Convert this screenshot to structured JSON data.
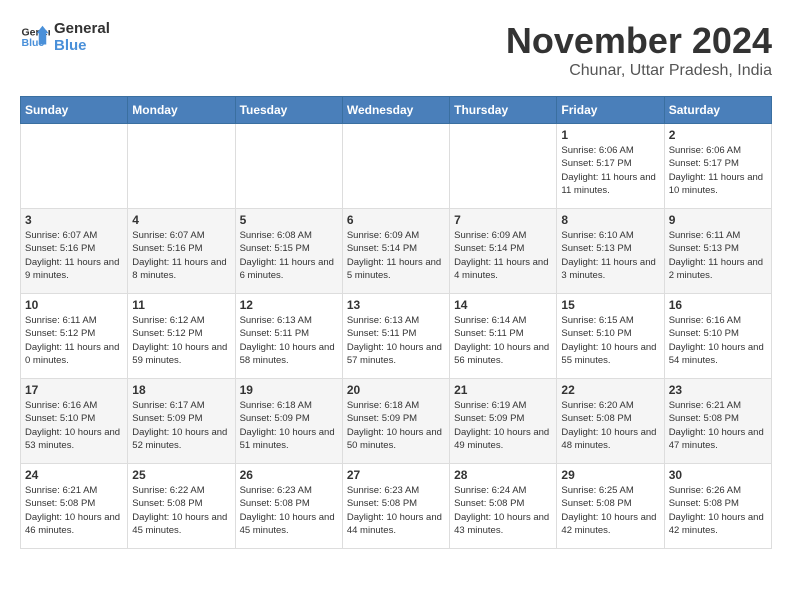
{
  "logo": {
    "line1": "General",
    "line2": "Blue"
  },
  "title": "November 2024",
  "subtitle": "Chunar, Uttar Pradesh, India",
  "headers": [
    "Sunday",
    "Monday",
    "Tuesday",
    "Wednesday",
    "Thursday",
    "Friday",
    "Saturday"
  ],
  "weeks": [
    [
      {
        "day": "",
        "info": ""
      },
      {
        "day": "",
        "info": ""
      },
      {
        "day": "",
        "info": ""
      },
      {
        "day": "",
        "info": ""
      },
      {
        "day": "",
        "info": ""
      },
      {
        "day": "1",
        "info": "Sunrise: 6:06 AM\nSunset: 5:17 PM\nDaylight: 11 hours and 11 minutes."
      },
      {
        "day": "2",
        "info": "Sunrise: 6:06 AM\nSunset: 5:17 PM\nDaylight: 11 hours and 10 minutes."
      }
    ],
    [
      {
        "day": "3",
        "info": "Sunrise: 6:07 AM\nSunset: 5:16 PM\nDaylight: 11 hours and 9 minutes."
      },
      {
        "day": "4",
        "info": "Sunrise: 6:07 AM\nSunset: 5:16 PM\nDaylight: 11 hours and 8 minutes."
      },
      {
        "day": "5",
        "info": "Sunrise: 6:08 AM\nSunset: 5:15 PM\nDaylight: 11 hours and 6 minutes."
      },
      {
        "day": "6",
        "info": "Sunrise: 6:09 AM\nSunset: 5:14 PM\nDaylight: 11 hours and 5 minutes."
      },
      {
        "day": "7",
        "info": "Sunrise: 6:09 AM\nSunset: 5:14 PM\nDaylight: 11 hours and 4 minutes."
      },
      {
        "day": "8",
        "info": "Sunrise: 6:10 AM\nSunset: 5:13 PM\nDaylight: 11 hours and 3 minutes."
      },
      {
        "day": "9",
        "info": "Sunrise: 6:11 AM\nSunset: 5:13 PM\nDaylight: 11 hours and 2 minutes."
      }
    ],
    [
      {
        "day": "10",
        "info": "Sunrise: 6:11 AM\nSunset: 5:12 PM\nDaylight: 11 hours and 0 minutes."
      },
      {
        "day": "11",
        "info": "Sunrise: 6:12 AM\nSunset: 5:12 PM\nDaylight: 10 hours and 59 minutes."
      },
      {
        "day": "12",
        "info": "Sunrise: 6:13 AM\nSunset: 5:11 PM\nDaylight: 10 hours and 58 minutes."
      },
      {
        "day": "13",
        "info": "Sunrise: 6:13 AM\nSunset: 5:11 PM\nDaylight: 10 hours and 57 minutes."
      },
      {
        "day": "14",
        "info": "Sunrise: 6:14 AM\nSunset: 5:11 PM\nDaylight: 10 hours and 56 minutes."
      },
      {
        "day": "15",
        "info": "Sunrise: 6:15 AM\nSunset: 5:10 PM\nDaylight: 10 hours and 55 minutes."
      },
      {
        "day": "16",
        "info": "Sunrise: 6:16 AM\nSunset: 5:10 PM\nDaylight: 10 hours and 54 minutes."
      }
    ],
    [
      {
        "day": "17",
        "info": "Sunrise: 6:16 AM\nSunset: 5:10 PM\nDaylight: 10 hours and 53 minutes."
      },
      {
        "day": "18",
        "info": "Sunrise: 6:17 AM\nSunset: 5:09 PM\nDaylight: 10 hours and 52 minutes."
      },
      {
        "day": "19",
        "info": "Sunrise: 6:18 AM\nSunset: 5:09 PM\nDaylight: 10 hours and 51 minutes."
      },
      {
        "day": "20",
        "info": "Sunrise: 6:18 AM\nSunset: 5:09 PM\nDaylight: 10 hours and 50 minutes."
      },
      {
        "day": "21",
        "info": "Sunrise: 6:19 AM\nSunset: 5:09 PM\nDaylight: 10 hours and 49 minutes."
      },
      {
        "day": "22",
        "info": "Sunrise: 6:20 AM\nSunset: 5:08 PM\nDaylight: 10 hours and 48 minutes."
      },
      {
        "day": "23",
        "info": "Sunrise: 6:21 AM\nSunset: 5:08 PM\nDaylight: 10 hours and 47 minutes."
      }
    ],
    [
      {
        "day": "24",
        "info": "Sunrise: 6:21 AM\nSunset: 5:08 PM\nDaylight: 10 hours and 46 minutes."
      },
      {
        "day": "25",
        "info": "Sunrise: 6:22 AM\nSunset: 5:08 PM\nDaylight: 10 hours and 45 minutes."
      },
      {
        "day": "26",
        "info": "Sunrise: 6:23 AM\nSunset: 5:08 PM\nDaylight: 10 hours and 45 minutes."
      },
      {
        "day": "27",
        "info": "Sunrise: 6:23 AM\nSunset: 5:08 PM\nDaylight: 10 hours and 44 minutes."
      },
      {
        "day": "28",
        "info": "Sunrise: 6:24 AM\nSunset: 5:08 PM\nDaylight: 10 hours and 43 minutes."
      },
      {
        "day": "29",
        "info": "Sunrise: 6:25 AM\nSunset: 5:08 PM\nDaylight: 10 hours and 42 minutes."
      },
      {
        "day": "30",
        "info": "Sunrise: 6:26 AM\nSunset: 5:08 PM\nDaylight: 10 hours and 42 minutes."
      }
    ]
  ]
}
